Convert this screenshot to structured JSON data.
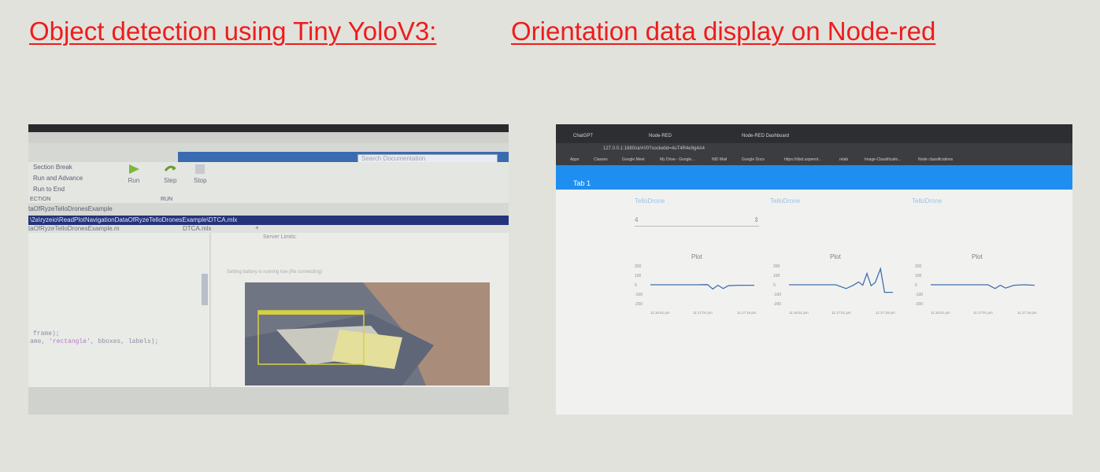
{
  "headings": {
    "left": "Object detection using Tiny YoloV3:",
    "right": "Orientation data display on Node-red"
  },
  "matlab": {
    "search_placeholder": "Search Documentation",
    "section_break": "Section Break",
    "run_and_advance": "Run and Advance",
    "run_to_end": "Run to End",
    "section_caption": "ECTION",
    "run_caption": "RUN",
    "run": "Run",
    "step": "Step",
    "stop": "Stop",
    "folder": "taOfRyzeTelloDronesExample",
    "path": "\\2a\\ryzeio\\ReadPlotNavigationDataOfRyzeTelloDronesExample\\DTCA.mlx",
    "tab_file": "taOfRyzeTelloDronesExample.m",
    "tab_active": "DTCA.mlx",
    "tab_plus": "+",
    "code_line1": "frame);",
    "code_line2a": "ame, ",
    "code_line2b": "'rectangle'",
    "code_line2c": ", bboxes, labels);",
    "output_header": "Server Limits:",
    "output_warning": "Setting battery is running low (Re connecting)"
  },
  "nodered": {
    "tab1_label": "ChatGPT",
    "tab2_label": "Node-RED",
    "tab3_label": "Node-RED Dashboard",
    "url": "127.0.0.1:1880/ui/#!/0?socketid=4uT4R4e9g4A4",
    "bookmarks": [
      "Apps",
      "Classes",
      "Google Meet",
      "My Drive - Google...",
      "NID Mail",
      "Google Docs",
      "https://dlsd.uspennl...",
      "relab",
      "Image-Classificatio...",
      "Node classifications"
    ],
    "dashboard_tab": "Tab 1",
    "group_labels": [
      "TelloDrone",
      "TelloDrone",
      "TelloDrone"
    ],
    "select_value": "4",
    "plot_titles": [
      "Plot",
      "Plot",
      "Plot"
    ],
    "axis_ticks": [
      "200",
      "100",
      "0",
      "-100",
      "-200"
    ],
    "time_ticks": [
      "11:16:51 pm",
      "11:17:01 pm",
      "11:17:16 pm"
    ]
  },
  "chart_data": [
    {
      "type": "line",
      "title": "Plot",
      "x": [
        0,
        0.15,
        0.3,
        0.45,
        0.55,
        0.6,
        0.65,
        0.7,
        0.75,
        0.85,
        1
      ],
      "values": [
        0,
        0,
        0,
        0,
        2,
        -45,
        -5,
        -40,
        -10,
        -5,
        -5
      ],
      "ylim": [
        -200,
        200
      ]
    },
    {
      "type": "line",
      "title": "Plot",
      "x": [
        0,
        0.2,
        0.45,
        0.55,
        0.62,
        0.67,
        0.71,
        0.75,
        0.79,
        0.83,
        0.88,
        0.92,
        1
      ],
      "values": [
        0,
        0,
        0,
        -40,
        -5,
        30,
        -5,
        120,
        -10,
        25,
        170,
        -80,
        -80
      ],
      "ylim": [
        -200,
        200
      ]
    },
    {
      "type": "line",
      "title": "Plot",
      "x": [
        0,
        0.3,
        0.55,
        0.62,
        0.67,
        0.72,
        0.8,
        0.9,
        1
      ],
      "values": [
        0,
        0,
        0,
        -40,
        -5,
        -35,
        -5,
        0,
        -5
      ],
      "ylim": [
        -200,
        200
      ]
    }
  ]
}
